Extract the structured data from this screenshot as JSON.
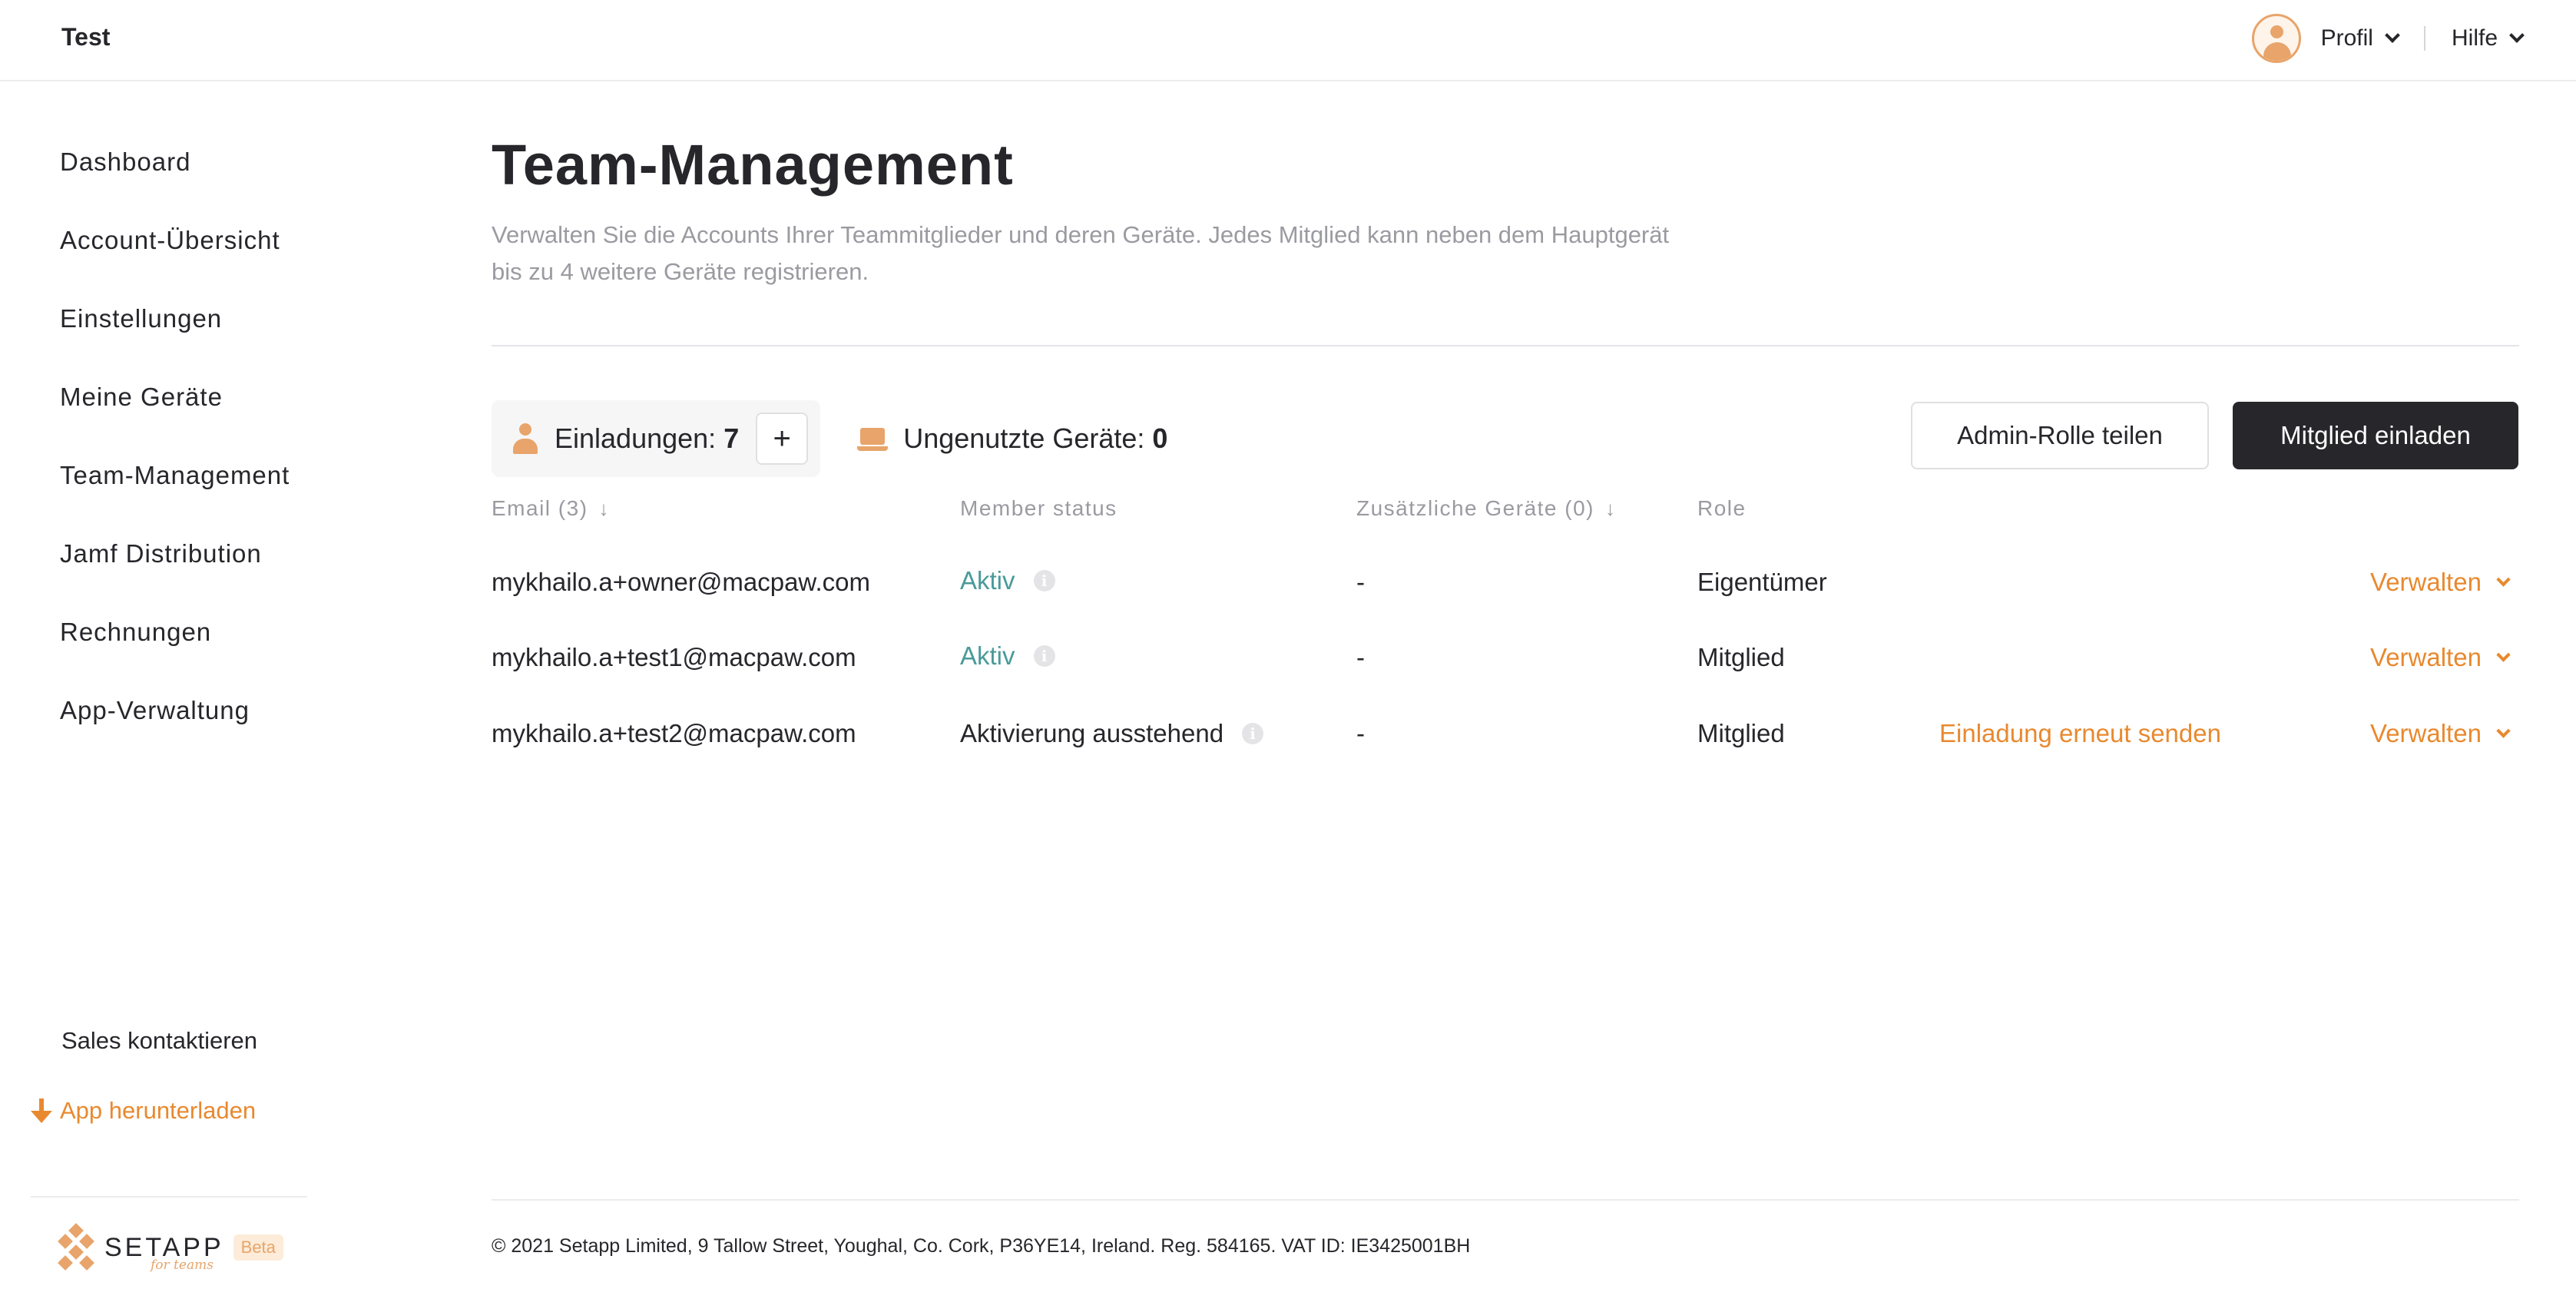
{
  "header": {
    "brand": "Test",
    "profile_label": "Profil",
    "help_label": "Hilfe"
  },
  "sidebar": {
    "items": [
      {
        "label": "Dashboard"
      },
      {
        "label": "Account-Übersicht"
      },
      {
        "label": "Einstellungen"
      },
      {
        "label": "Meine Geräte"
      },
      {
        "label": "Team-Management"
      },
      {
        "label": "Jamf Distribution"
      },
      {
        "label": "Rechnungen"
      },
      {
        "label": "App-Verwaltung"
      }
    ],
    "sales_label": "Sales kontaktieren",
    "download_label": "App herunterladen",
    "logo": {
      "name": "SETAPP",
      "sub": "for teams",
      "badge": "Beta"
    }
  },
  "main": {
    "title": "Team-Management",
    "description": "Verwalten Sie die Accounts Ihrer Teammitglieder und deren Geräte. Jedes Mitglied kann neben dem Hauptgerät bis zu 4 weitere Geräte registrieren.",
    "stats": {
      "invites_label": "Einladungen:",
      "invites_value": "7",
      "add_symbol": "+",
      "devices_label": "Ungenutzte Geräte:",
      "devices_value": "0"
    },
    "buttons": {
      "share_admin": "Admin-Rolle teilen",
      "invite_member": "Mitglied einladen"
    },
    "table": {
      "columns": {
        "email": "Email (3)",
        "status": "Member status",
        "devices": "Zusätzliche Geräte (0)",
        "role": "Role"
      },
      "sort_glyph": "↓",
      "info_glyph": "i",
      "rows": [
        {
          "email": "mykhailo.a+owner@macpaw.com",
          "status": "Aktiv",
          "devices": "-",
          "role": "Eigentümer",
          "resend": "",
          "manage": "Verwalten"
        },
        {
          "email": "mykhailo.a+test1@macpaw.com",
          "status": "Aktiv",
          "devices": "-",
          "role": "Mitglied",
          "resend": "",
          "manage": "Verwalten"
        },
        {
          "email": "mykhailo.a+test2@macpaw.com",
          "status": "Aktivierung ausstehend",
          "devices": "-",
          "role": "Mitglied",
          "resend": "Einladung erneut senden",
          "manage": "Verwalten"
        }
      ]
    }
  },
  "footer": {
    "text": "© 2021 Setapp Limited, 9 Tallow Street, Youghal, Co. Cork, P36YE14, Ireland. Reg. 584165. VAT ID: IE3425001BH"
  },
  "colors": {
    "accent": "#e8892f",
    "accent_light": "#e8a46a",
    "active_status": "#4a9a9a",
    "primary_button": "#26262b",
    "muted_text": "#9a9aa1"
  }
}
